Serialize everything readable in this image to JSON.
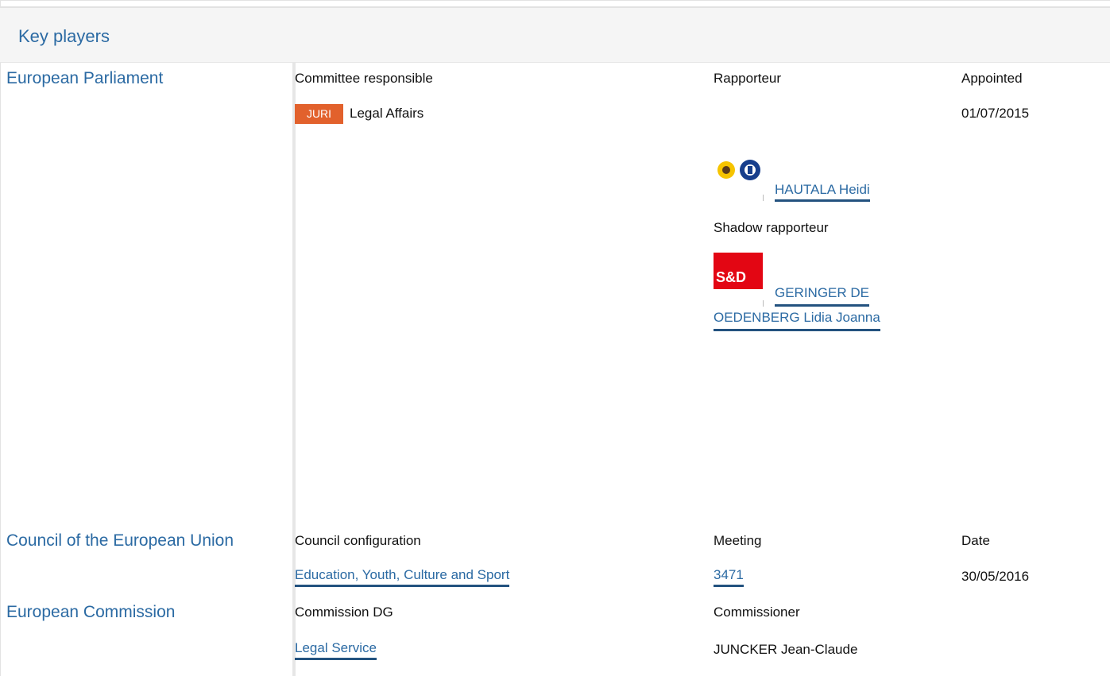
{
  "header": {
    "title": "Key players"
  },
  "sections": {
    "parliament": {
      "label": "European Parliament",
      "col1": "Committee responsible",
      "col2": "Rapporteur",
      "col3": "Appointed",
      "committee_code": "JURI",
      "committee_name": "Legal Affairs",
      "appointed_date": "01/07/2015",
      "rapporteur_name": "HAUTALA Heidi",
      "shadow_label": "Shadow rapporteur",
      "shadow_logo": "S&D",
      "shadow_name_line1": "GERINGER DE",
      "shadow_name_line2": "OEDENBERG Lidia Joanna"
    },
    "council": {
      "label": "Council of the European Union",
      "col1": "Council configuration",
      "col2": "Meeting",
      "col3": "Date",
      "configuration": "Education, Youth, Culture and Sport",
      "meeting": "3471",
      "date": "30/05/2016"
    },
    "commission": {
      "label": "European Commission",
      "col1": "Commission DG",
      "col2": "Commissioner",
      "dg": "Legal Service",
      "commissioner": "JUNCKER Jean-Claude"
    }
  },
  "colors": {
    "accent": "#2b6aa3",
    "link_underline": "#23527f",
    "badge": "#e2612c",
    "sd_red": "#e30613"
  },
  "icons": {
    "greens_logo": "greens-efa-group-icon",
    "sd_logo": "sd-group-icon"
  }
}
